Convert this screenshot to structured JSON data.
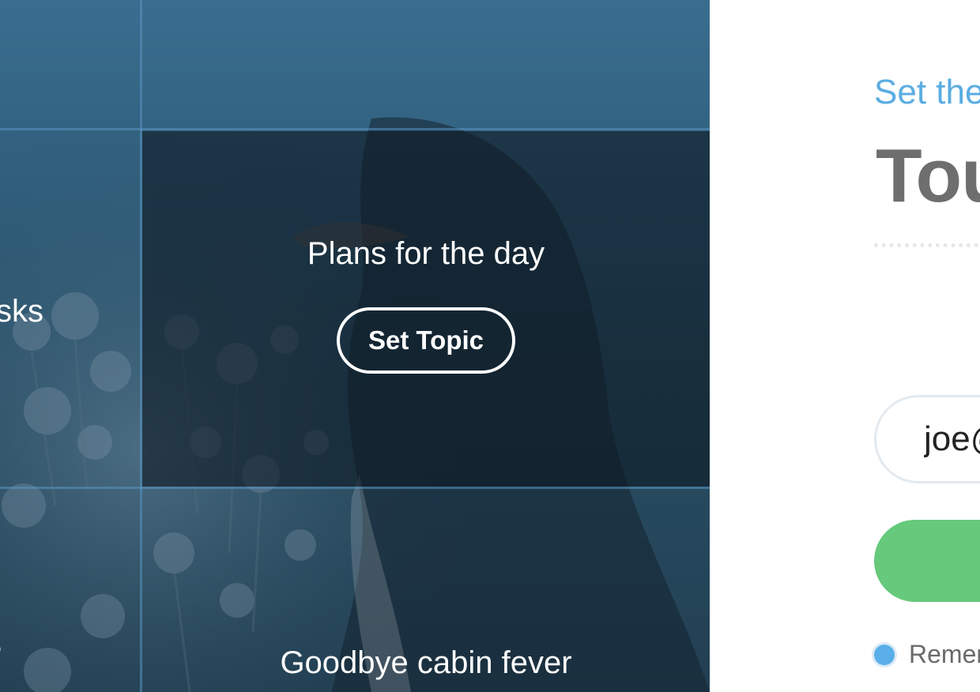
{
  "tiles": {
    "left_mid_title": "sks",
    "active_title": "Plans for the day",
    "active_button": "Set Topic",
    "left_bottom_title": "?",
    "bottom_title": "Goodbye cabin fever"
  },
  "login": {
    "subtitle": "Set the",
    "title": "Tou",
    "email_value": "joe@",
    "remember_label": "Remem"
  },
  "colors": {
    "accent_blue": "#5aade2",
    "button_green": "#66c97b",
    "title_gray": "#6e6e6e"
  }
}
